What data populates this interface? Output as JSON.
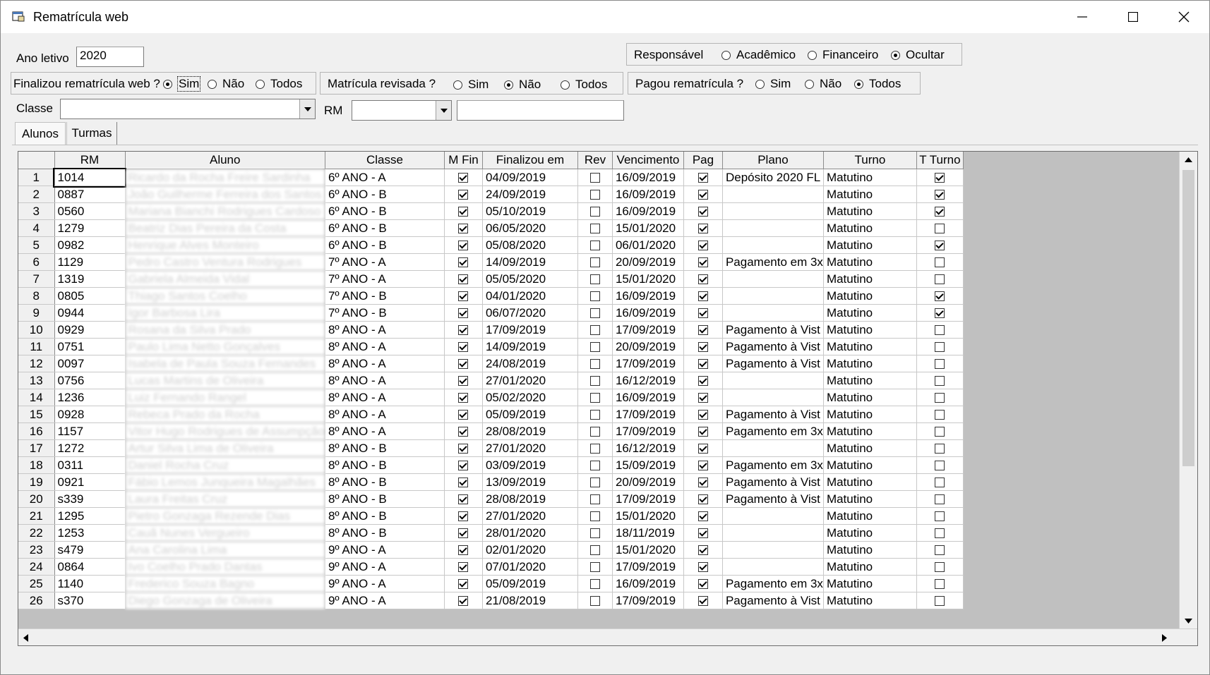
{
  "window": {
    "title": "Rematrícula web",
    "minimize_glyph": "─",
    "maximize_glyph": "☐",
    "close_glyph": "✕"
  },
  "filters": {
    "ano_letivo_label": "Ano letivo",
    "ano_letivo_value": "2020",
    "responsavel": {
      "label": "Responsável",
      "options": [
        {
          "label": "Acadêmico",
          "selected": false
        },
        {
          "label": "Financeiro",
          "selected": false
        },
        {
          "label": "Ocultar",
          "selected": true
        }
      ]
    },
    "finalizou": {
      "label": "Finalizou rematrícula web ?",
      "options": [
        {
          "label": "Sim",
          "selected": true
        },
        {
          "label": "Não",
          "selected": false
        },
        {
          "label": "Todos",
          "selected": false
        }
      ]
    },
    "revisada": {
      "label": "Matrícula revisada ?",
      "options": [
        {
          "label": "Sim",
          "selected": false
        },
        {
          "label": "Não",
          "selected": true
        },
        {
          "label": "Todos",
          "selected": false
        }
      ]
    },
    "pagou": {
      "label": "Pagou rematrícula ?",
      "options": [
        {
          "label": "Sim",
          "selected": false
        },
        {
          "label": "Não",
          "selected": false
        },
        {
          "label": "Todos",
          "selected": true
        }
      ]
    },
    "classe_label": "Classe",
    "classe_value": "",
    "rm_label": "RM",
    "rm_value": "",
    "search_value": ""
  },
  "tabs": [
    {
      "label": "Alunos",
      "active": true
    },
    {
      "label": "Turmas",
      "active": false
    }
  ],
  "grid": {
    "columns": [
      "",
      "RM",
      "Aluno",
      "Classe",
      "M Fin",
      "Finalizou em",
      "Rev",
      "Vencimento",
      "Pag",
      "Plano",
      "Turno",
      "T Turno"
    ],
    "rows": [
      {
        "n": "1",
        "rm": "1014",
        "aluno": "Ricardo da Rocha Freire Sardinha",
        "classe": "6º ANO - A",
        "mfin": true,
        "fin": "04/09/2019",
        "rev": false,
        "venc": "16/09/2019",
        "pag": true,
        "plano": "Depósito 2020 FL",
        "turno": "Matutino",
        "tturno": true
      },
      {
        "n": "2",
        "rm": "0887",
        "aluno": "João Guilherme Ferreira dos Santos",
        "classe": "6º ANO - B",
        "mfin": true,
        "fin": "24/09/2019",
        "rev": false,
        "venc": "16/09/2019",
        "pag": true,
        "plano": "",
        "turno": "Matutino",
        "tturno": true
      },
      {
        "n": "3",
        "rm": "0560",
        "aluno": "Mariana Bianchi Rodrigues Cardoso",
        "classe": "6º ANO - B",
        "mfin": true,
        "fin": "05/10/2019",
        "rev": false,
        "venc": "16/09/2019",
        "pag": true,
        "plano": "",
        "turno": "Matutino",
        "tturno": true
      },
      {
        "n": "4",
        "rm": "1279",
        "aluno": "Beatriz Dias Pereira da Costa",
        "classe": "6º ANO - B",
        "mfin": true,
        "fin": "06/05/2020",
        "rev": false,
        "venc": "15/01/2020",
        "pag": true,
        "plano": "",
        "turno": "Matutino",
        "tturno": false
      },
      {
        "n": "5",
        "rm": "0982",
        "aluno": "Henrique Alves Monteiro",
        "classe": "6º ANO - B",
        "mfin": true,
        "fin": "05/08/2020",
        "rev": false,
        "venc": "06/01/2020",
        "pag": true,
        "plano": "",
        "turno": "Matutino",
        "tturno": true
      },
      {
        "n": "6",
        "rm": "1129",
        "aluno": "Pedro Castro Ventura Rodrigues",
        "classe": "7º ANO - A",
        "mfin": true,
        "fin": "14/09/2019",
        "rev": false,
        "venc": "20/09/2019",
        "pag": true,
        "plano": "Pagamento em 3x",
        "turno": "Matutino",
        "tturno": false
      },
      {
        "n": "7",
        "rm": "1319",
        "aluno": "Gabriela Almeida Vidal",
        "classe": "7º ANO - A",
        "mfin": true,
        "fin": "05/05/2020",
        "rev": false,
        "venc": "15/01/2020",
        "pag": true,
        "plano": "",
        "turno": "Matutino",
        "tturno": false
      },
      {
        "n": "8",
        "rm": "0805",
        "aluno": "Thiago Santos Coelho",
        "classe": "7º ANO - B",
        "mfin": true,
        "fin": "04/01/2020",
        "rev": false,
        "venc": "16/09/2019",
        "pag": true,
        "plano": "",
        "turno": "Matutino",
        "tturno": true
      },
      {
        "n": "9",
        "rm": "0944",
        "aluno": "Igor Barbosa Lira",
        "classe": "7º ANO - B",
        "mfin": true,
        "fin": "06/07/2020",
        "rev": false,
        "venc": "16/09/2019",
        "pag": true,
        "plano": "",
        "turno": "Matutino",
        "tturno": true
      },
      {
        "n": "10",
        "rm": "0929",
        "aluno": "Rosana da Silva Prado",
        "classe": "8º ANO - A",
        "mfin": true,
        "fin": "17/09/2019",
        "rev": false,
        "venc": "17/09/2019",
        "pag": true,
        "plano": "Pagamento à Vist",
        "turno": "Matutino",
        "tturno": false
      },
      {
        "n": "11",
        "rm": "0751",
        "aluno": "Paulo Lima Netto Gonçalves",
        "classe": "8º ANO - A",
        "mfin": true,
        "fin": "14/09/2019",
        "rev": false,
        "venc": "20/09/2019",
        "pag": true,
        "plano": "Pagamento à Vist",
        "turno": "Matutino",
        "tturno": false
      },
      {
        "n": "12",
        "rm": "0097",
        "aluno": "Isabela de Paula Souza Fernandes",
        "classe": "8º ANO - A",
        "mfin": true,
        "fin": "24/08/2019",
        "rev": false,
        "venc": "17/09/2019",
        "pag": true,
        "plano": "Pagamento à Vist",
        "turno": "Matutino",
        "tturno": false
      },
      {
        "n": "13",
        "rm": "0756",
        "aluno": "Lucas Martins de Oliveira",
        "classe": "8º ANO - A",
        "mfin": true,
        "fin": "27/01/2020",
        "rev": false,
        "venc": "16/12/2019",
        "pag": true,
        "plano": "",
        "turno": "Matutino",
        "tturno": false
      },
      {
        "n": "14",
        "rm": "1236",
        "aluno": "Luiz Fernando Rangel",
        "classe": "8º ANO - A",
        "mfin": true,
        "fin": "05/02/2020",
        "rev": false,
        "venc": "16/09/2019",
        "pag": true,
        "plano": "",
        "turno": "Matutino",
        "tturno": false
      },
      {
        "n": "15",
        "rm": "0928",
        "aluno": "Rebeca Prado da Rocha",
        "classe": "8º ANO - A",
        "mfin": true,
        "fin": "05/09/2019",
        "rev": false,
        "venc": "17/09/2019",
        "pag": true,
        "plano": "Pagamento à Vist",
        "turno": "Matutino",
        "tturno": false
      },
      {
        "n": "16",
        "rm": "1157",
        "aluno": "Vitor Hugo Rodrigues de Assumpção",
        "classe": "8º ANO - A",
        "mfin": true,
        "fin": "28/08/2019",
        "rev": false,
        "venc": "17/09/2019",
        "pag": true,
        "plano": "Pagamento em 3x",
        "turno": "Matutino",
        "tturno": false
      },
      {
        "n": "17",
        "rm": "1272",
        "aluno": "Artur Silva Lima de Oliveira",
        "classe": "8º ANO - B",
        "mfin": true,
        "fin": "27/01/2020",
        "rev": false,
        "venc": "16/12/2019",
        "pag": true,
        "plano": "",
        "turno": "Matutino",
        "tturno": false
      },
      {
        "n": "18",
        "rm": "0311",
        "aluno": "Daniel Rocha Cruz",
        "classe": "8º ANO - B",
        "mfin": true,
        "fin": "03/09/2019",
        "rev": false,
        "venc": "15/09/2019",
        "pag": true,
        "plano": "Pagamento em 3x",
        "turno": "Matutino",
        "tturno": false
      },
      {
        "n": "19",
        "rm": "0921",
        "aluno": "Fábio Lemos Junqueira Magalhães",
        "classe": "8º ANO - B",
        "mfin": true,
        "fin": "13/09/2019",
        "rev": false,
        "venc": "20/09/2019",
        "pag": true,
        "plano": "Pagamento à Vist",
        "turno": "Matutino",
        "tturno": false
      },
      {
        "n": "20",
        "rm": "s339",
        "aluno": "Laura Freitas Cruz",
        "classe": "8º ANO - B",
        "mfin": true,
        "fin": "28/08/2019",
        "rev": false,
        "venc": "17/09/2019",
        "pag": true,
        "plano": "Pagamento à Vist",
        "turno": "Matutino",
        "tturno": false
      },
      {
        "n": "21",
        "rm": "1295",
        "aluno": "Pietro Gonzaga Rezende Dias",
        "classe": "8º ANO - B",
        "mfin": true,
        "fin": "27/01/2020",
        "rev": false,
        "venc": "15/01/2020",
        "pag": true,
        "plano": "",
        "turno": "Matutino",
        "tturno": false
      },
      {
        "n": "22",
        "rm": "1253",
        "aluno": "Cauã Nunes Vergueiro",
        "classe": "8º ANO - B",
        "mfin": true,
        "fin": "28/01/2020",
        "rev": false,
        "venc": "18/11/2019",
        "pag": true,
        "plano": "",
        "turno": "Matutino",
        "tturno": false
      },
      {
        "n": "23",
        "rm": "s479",
        "aluno": "Ana Carolina Lima",
        "classe": "9º ANO - A",
        "mfin": true,
        "fin": "02/01/2020",
        "rev": false,
        "venc": "15/01/2020",
        "pag": true,
        "plano": "",
        "turno": "Matutino",
        "tturno": false
      },
      {
        "n": "24",
        "rm": "0864",
        "aluno": "Ivo Coelho Prado Dantas",
        "classe": "9º ANO - A",
        "mfin": true,
        "fin": "07/01/2020",
        "rev": false,
        "venc": "17/09/2019",
        "pag": true,
        "plano": "",
        "turno": "Matutino",
        "tturno": false
      },
      {
        "n": "25",
        "rm": "1140",
        "aluno": "Frederico Souza Bagno",
        "classe": "9º ANO - A",
        "mfin": true,
        "fin": "05/09/2019",
        "rev": false,
        "venc": "16/09/2019",
        "pag": true,
        "plano": "Pagamento em 3x",
        "turno": "Matutino",
        "tturno": false
      },
      {
        "n": "26",
        "rm": "s370",
        "aluno": "Diego Gonzaga de Oliveira",
        "classe": "9º ANO - A",
        "mfin": true,
        "fin": "21/08/2019",
        "rev": false,
        "venc": "17/09/2019",
        "pag": true,
        "plano": "Pagamento à Vist",
        "turno": "Matutino",
        "tturno": false
      }
    ]
  }
}
